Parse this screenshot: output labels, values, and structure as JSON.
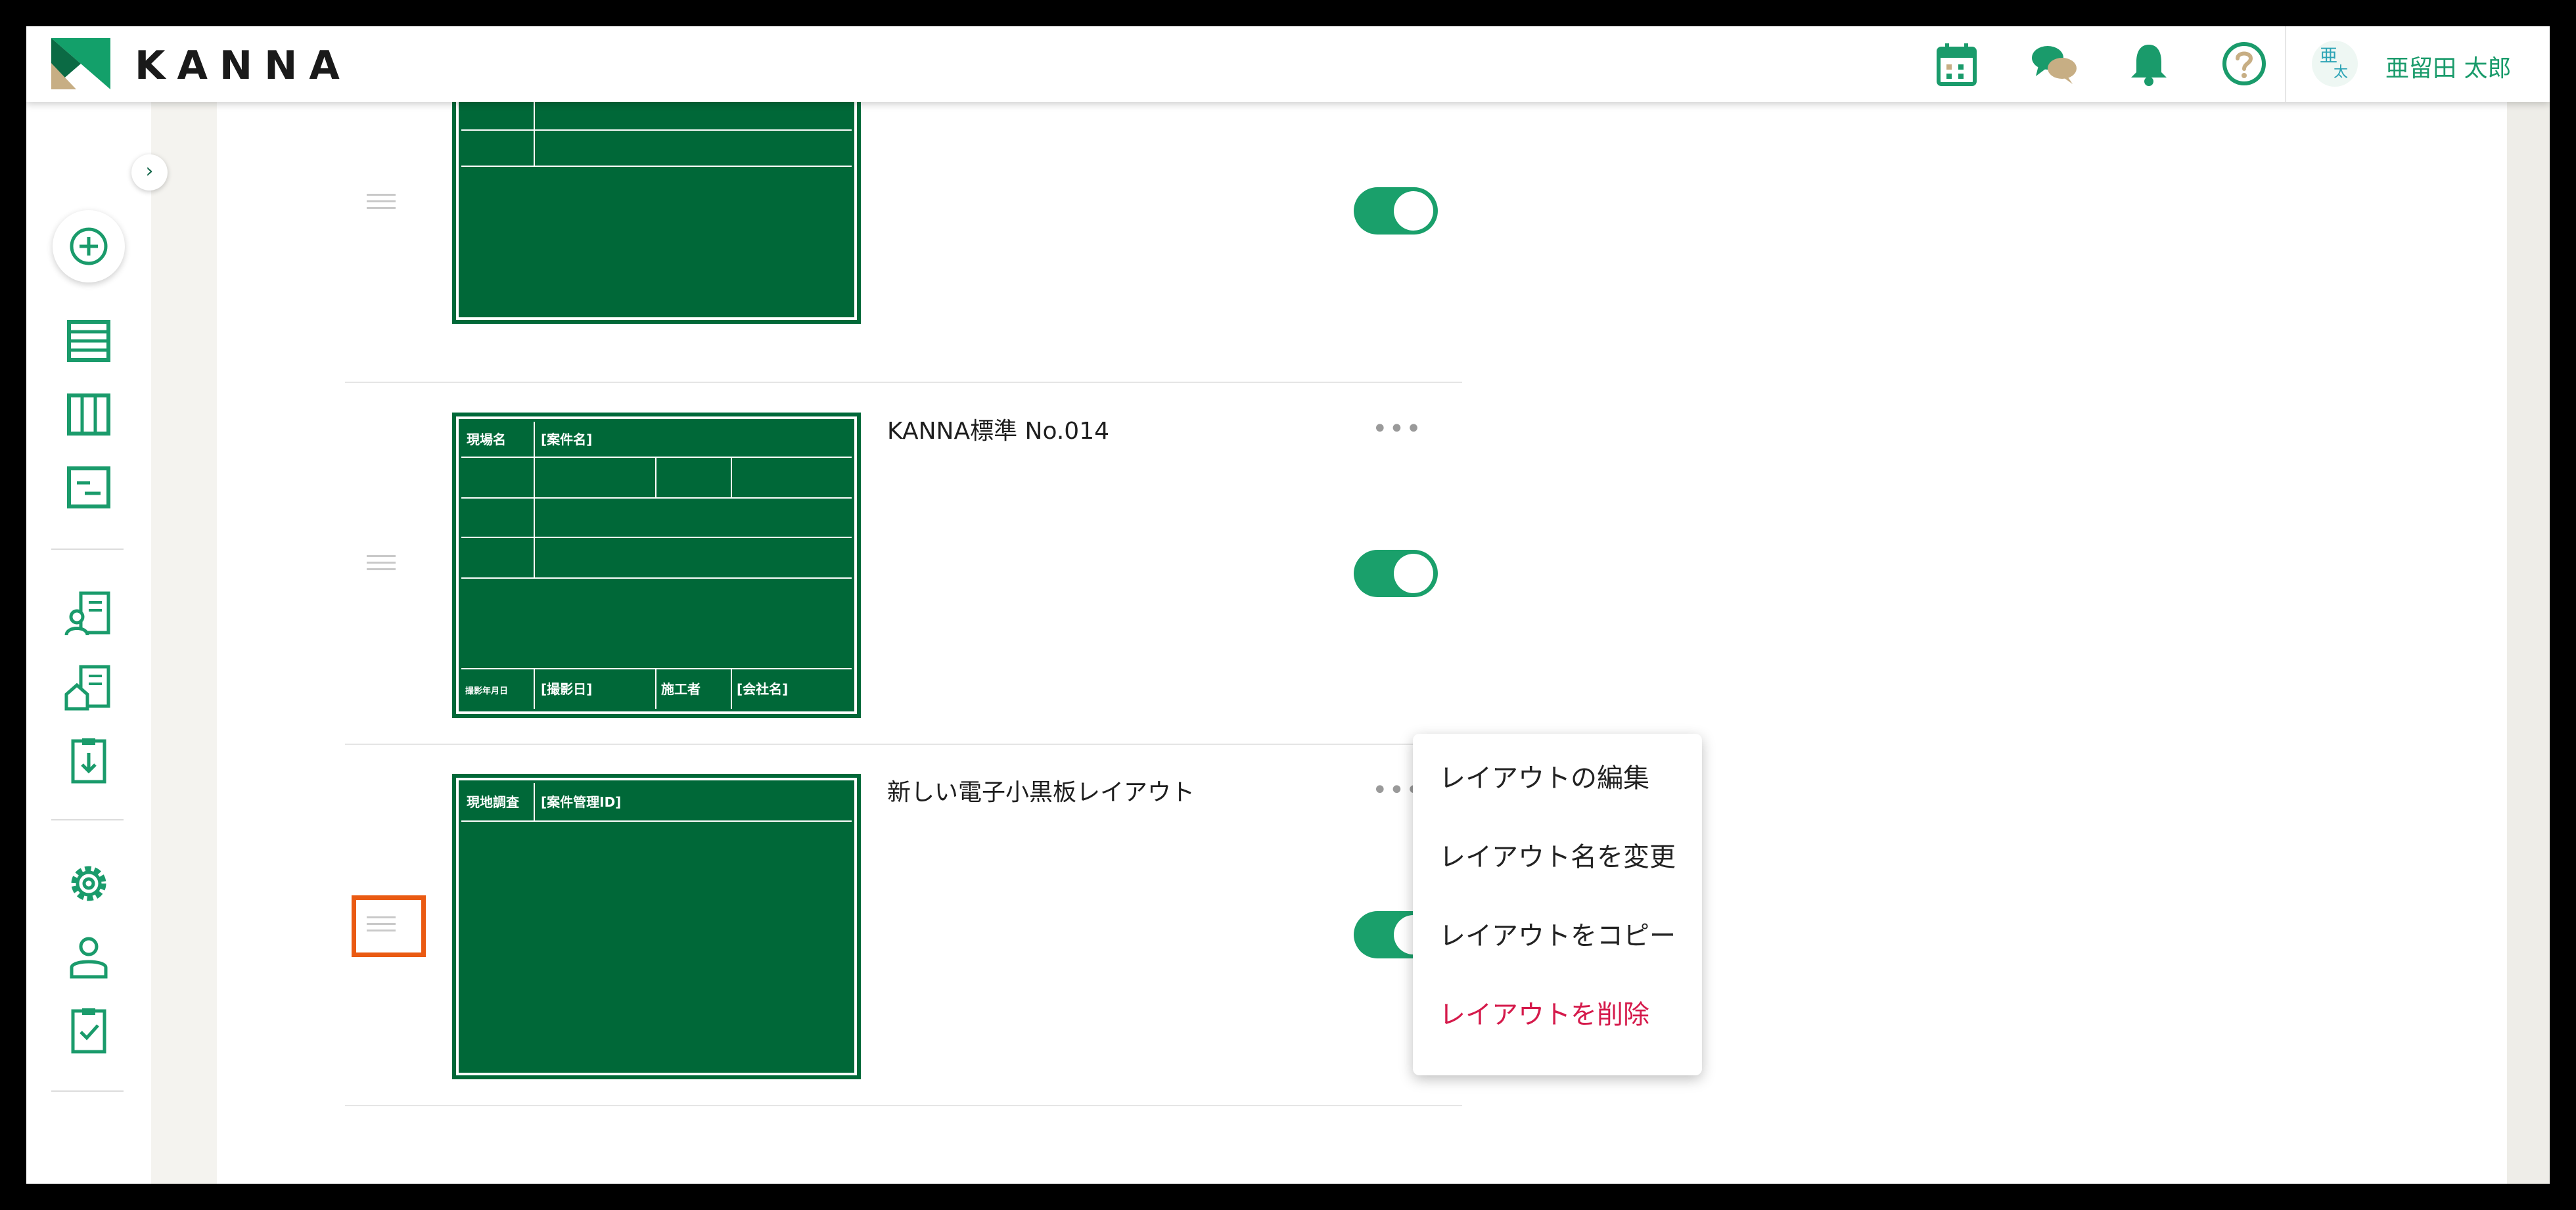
{
  "app": {
    "brand": "KANNA"
  },
  "header": {
    "user_name": "亜留田 太郎",
    "avatar_top": "亜",
    "avatar_bottom": "太"
  },
  "sidebar": {
    "toggle_glyph": "›"
  },
  "board_labels": {
    "site_name": "現場名",
    "project_name": "[案件名]",
    "shoot_date_label": "撮影年月日",
    "shoot_date": "[撮影日]",
    "builder_label": "施工者",
    "company": "[会社名]",
    "survey_label": "現地調査",
    "project_id": "[案件管理ID]"
  },
  "layouts": [
    {
      "name": "",
      "enabled": true
    },
    {
      "name": "KANNA標準 No.014",
      "enabled": true
    },
    {
      "name": "新しい電子小黒板レイアウト",
      "enabled": true
    }
  ],
  "more_glyph": "•••",
  "context_menu": {
    "items": [
      {
        "label": "レイアウトの編集"
      },
      {
        "label": "レイアウト名を変更"
      },
      {
        "label": "レイアウトをコピー"
      },
      {
        "label": "レイアウトを削除",
        "danger": true
      }
    ]
  },
  "colors": {
    "accent": "#1aa06b",
    "board": "#006838",
    "danger": "#d51a4b",
    "focus": "#ea5a12"
  }
}
